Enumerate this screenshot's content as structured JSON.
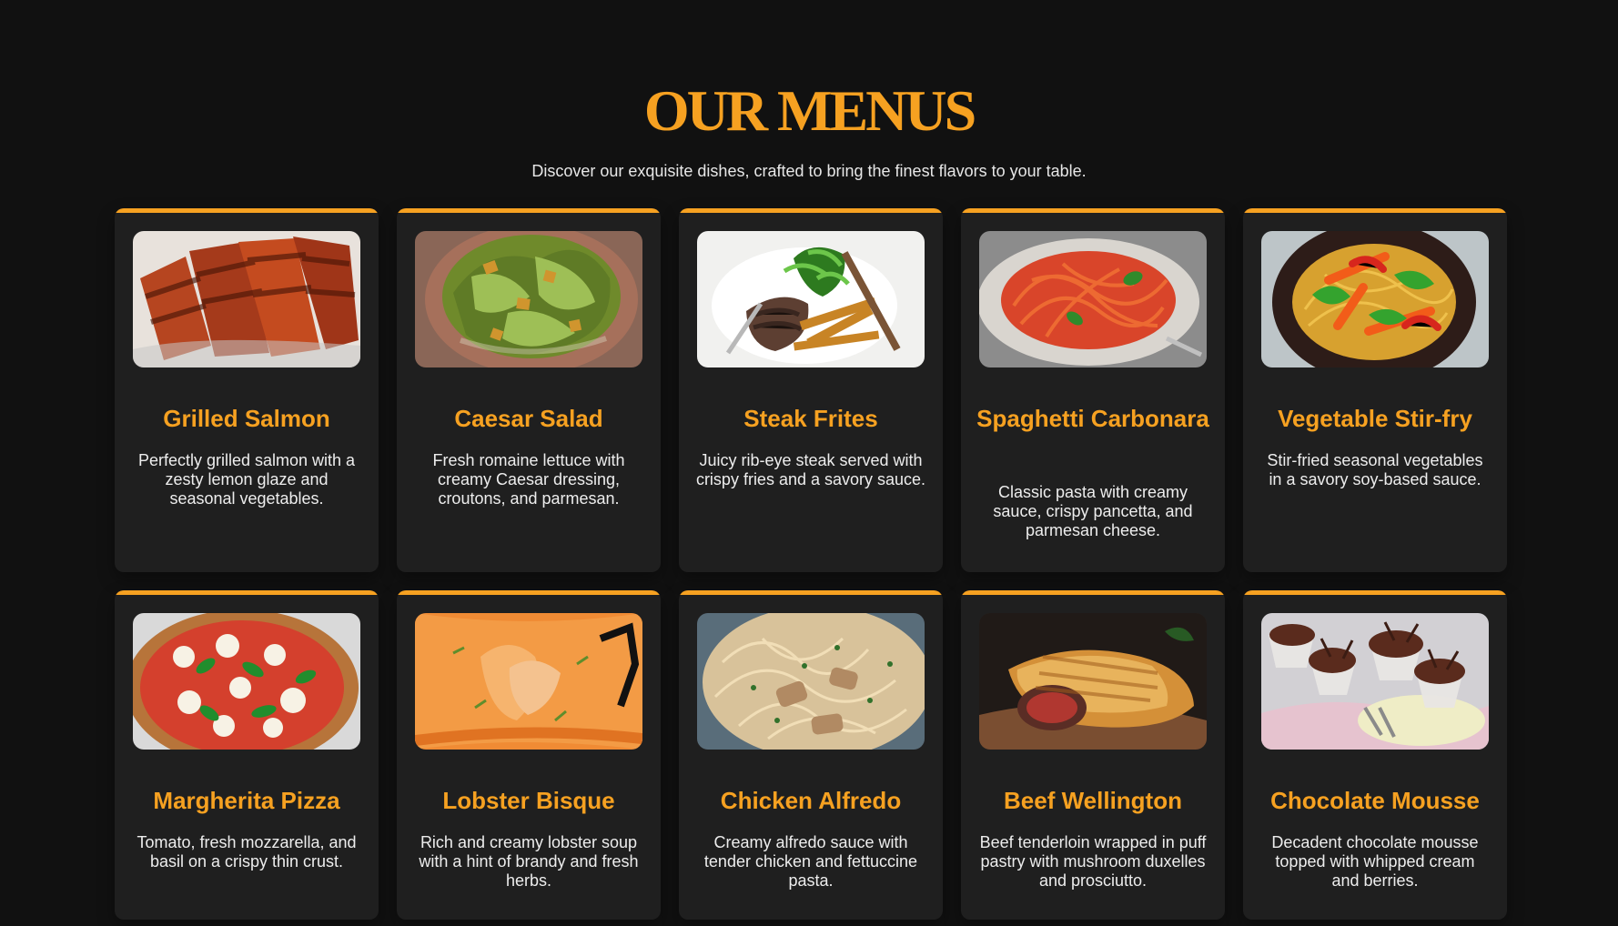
{
  "header": {
    "title": "OUR MENUS",
    "subtitle": "Discover our exquisite dishes, crafted to bring the finest flavors to your table."
  },
  "menu": {
    "items": [
      {
        "title": "Grilled Salmon",
        "description": "Perfectly grilled salmon with a zesty lemon glaze and seasonal vegetables.",
        "image": "grilled-salmon-photo"
      },
      {
        "title": "Caesar Salad",
        "description": "Fresh romaine lettuce with creamy Caesar dressing, croutons, and parmesan.",
        "image": "caesar-salad-photo"
      },
      {
        "title": "Steak Frites",
        "description": "Juicy rib-eye steak served with crispy fries and a savory sauce.",
        "image": "steak-frites-photo"
      },
      {
        "title": "Spaghetti Carbonara",
        "description": "Classic pasta with creamy sauce, crispy pancetta, and parmesan cheese.",
        "image": "spaghetti-carbonara-photo"
      },
      {
        "title": "Vegetable Stir-fry",
        "description": "Stir-fried seasonal vegetables in a savory soy-based sauce.",
        "image": "vegetable-stir-fry-photo"
      },
      {
        "title": "Margherita Pizza",
        "description": "Tomato, fresh mozzarella, and basil on a crispy thin crust.",
        "image": "margherita-pizza-photo"
      },
      {
        "title": "Lobster Bisque",
        "description": "Rich and creamy lobster soup with a hint of brandy and fresh herbs.",
        "image": "lobster-bisque-photo"
      },
      {
        "title": "Chicken Alfredo",
        "description": "Creamy alfredo sauce with tender chicken and fettuccine pasta.",
        "image": "chicken-alfredo-photo"
      },
      {
        "title": "Beef Wellington",
        "description": "Beef tenderloin wrapped in puff pastry with mushroom duxelles and prosciutto.",
        "image": "beef-wellington-photo"
      },
      {
        "title": "Chocolate Mousse",
        "description": "Decadent chocolate mousse topped with whipped cream and berries.",
        "image": "chocolate-mousse-photo"
      }
    ]
  },
  "colors": {
    "background": "#111111",
    "card": "#1f1f1f",
    "accent": "#f6a121",
    "text": "#ededed"
  }
}
